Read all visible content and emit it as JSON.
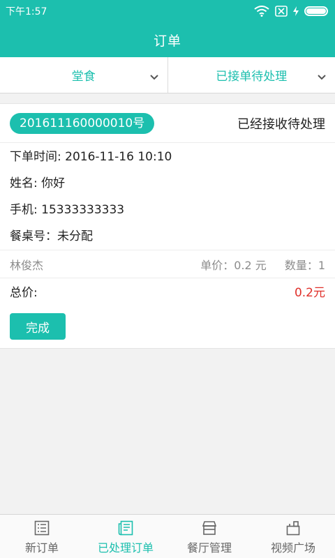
{
  "status_bar": {
    "time": "下午1:57"
  },
  "header": {
    "title": "订单"
  },
  "filters": [
    {
      "label": "堂食"
    },
    {
      "label": "已接单待处理"
    }
  ],
  "order": {
    "number": "201611160000010号",
    "status": "已经接收待处理",
    "time_line": "下单时间: 2016-11-16 10:10",
    "name_line": "姓名: 你好",
    "phone_line": "手机: 15333333333",
    "table_line": "餐桌号：未分配",
    "item": {
      "name": "林俊杰",
      "unit_price": "单价：0.2 元",
      "quantity": "数量：1"
    },
    "total_label": "总价:",
    "total_value": "0.2元",
    "complete_button": "完成"
  },
  "bottom_nav": [
    {
      "label": "新订单",
      "icon": "list-icon",
      "active": false
    },
    {
      "label": "已处理订单",
      "icon": "document-icon",
      "active": true
    },
    {
      "label": "餐厅管理",
      "icon": "store-icon",
      "active": false
    },
    {
      "label": "视频广场",
      "icon": "camera-icon",
      "active": false
    }
  ],
  "colors": {
    "primary": "#1cbfae",
    "price_red": "#e0302a"
  }
}
